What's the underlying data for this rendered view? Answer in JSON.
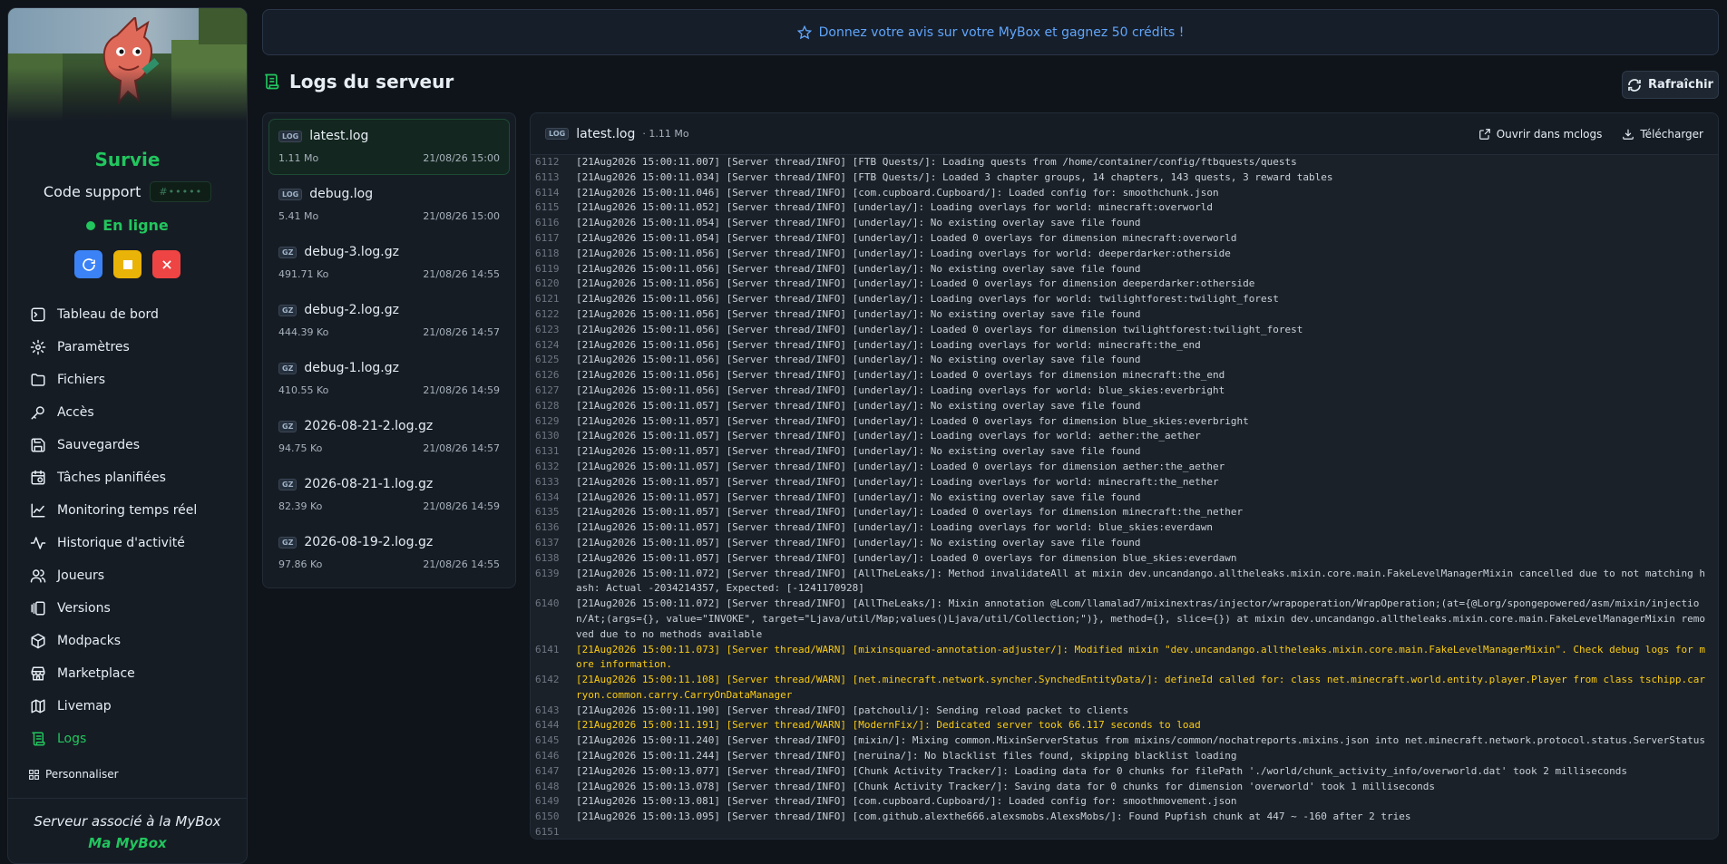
{
  "sidebar": {
    "server_name": "Survie",
    "support_label": "Code support",
    "support_code": "#•••••",
    "status": "En ligne",
    "nav": [
      {
        "label": "Tableau de bord",
        "icon": "terminal-icon"
      },
      {
        "label": "Paramètres",
        "icon": "gear-icon"
      },
      {
        "label": "Fichiers",
        "icon": "folder-icon"
      },
      {
        "label": "Accès",
        "icon": "key-icon"
      },
      {
        "label": "Sauvegardes",
        "icon": "save-icon"
      },
      {
        "label": "Tâches planifiées",
        "icon": "calendar-clock-icon"
      },
      {
        "label": "Monitoring temps réel",
        "icon": "chart-line-icon"
      },
      {
        "label": "Historique d'activité",
        "icon": "activity-icon"
      },
      {
        "label": "Joueurs",
        "icon": "users-icon"
      },
      {
        "label": "Versions",
        "icon": "versions-icon"
      },
      {
        "label": "Modpacks",
        "icon": "package-icon"
      },
      {
        "label": "Marketplace",
        "icon": "store-icon"
      },
      {
        "label": "Livemap",
        "icon": "map-icon"
      },
      {
        "label": "Logs",
        "icon": "scroll-icon"
      }
    ],
    "customize": "Personnaliser",
    "footer_text": "Serveur associé à la MyBox",
    "footer_link": "Ma MyBox"
  },
  "notice": "Donnez votre avis sur votre MyBox et gagnez 50 crédits !",
  "page_title": "Logs du serveur",
  "refresh_label": "Rafraîchir",
  "files": [
    {
      "badge": "LOG",
      "name": "latest.log",
      "size": "1.11 Mo",
      "date": "21/08/26 15:00"
    },
    {
      "badge": "LOG",
      "name": "debug.log",
      "size": "5.41 Mo",
      "date": "21/08/26 15:00"
    },
    {
      "badge": "GZ",
      "name": "debug-3.log.gz",
      "size": "491.71 Ko",
      "date": "21/08/26 14:55"
    },
    {
      "badge": "GZ",
      "name": "debug-2.log.gz",
      "size": "444.39 Ko",
      "date": "21/08/26 14:57"
    },
    {
      "badge": "GZ",
      "name": "debug-1.log.gz",
      "size": "410.55 Ko",
      "date": "21/08/26 14:59"
    },
    {
      "badge": "GZ",
      "name": "2026-08-21-2.log.gz",
      "size": "94.75 Ko",
      "date": "21/08/26 14:57"
    },
    {
      "badge": "GZ",
      "name": "2026-08-21-1.log.gz",
      "size": "82.39 Ko",
      "date": "21/08/26 14:59"
    },
    {
      "badge": "GZ",
      "name": "2026-08-19-2.log.gz",
      "size": "97.86 Ko",
      "date": "21/08/26 14:55"
    }
  ],
  "viewer": {
    "badge": "LOG",
    "file_name": "latest.log",
    "file_size": "· 1.11 Mo",
    "open_mclogs": "Ouvrir dans mclogs",
    "download": "Télécharger",
    "lines": [
      {
        "n": "6112",
        "t": "[21Aug2026 15:00:11.007] [Server thread/INFO] [FTB Quests/]: Loading quests from /home/container/config/ftbquests/quests",
        "w": false
      },
      {
        "n": "6113",
        "t": "[21Aug2026 15:00:11.034] [Server thread/INFO] [FTB Quests/]: Loaded 3 chapter groups, 14 chapters, 143 quests, 3 reward tables",
        "w": false
      },
      {
        "n": "6114",
        "t": "[21Aug2026 15:00:11.046] [Server thread/INFO] [com.cupboard.Cupboard/]: Loaded config for: smoothchunk.json",
        "w": false
      },
      {
        "n": "6115",
        "t": "[21Aug2026 15:00:11.052] [Server thread/INFO] [underlay/]: Loading overlays for world: minecraft:overworld",
        "w": false
      },
      {
        "n": "6116",
        "t": "[21Aug2026 15:00:11.054] [Server thread/INFO] [underlay/]: No existing overlay save file found",
        "w": false
      },
      {
        "n": "6117",
        "t": "[21Aug2026 15:00:11.054] [Server thread/INFO] [underlay/]: Loaded 0 overlays for dimension minecraft:overworld",
        "w": false
      },
      {
        "n": "6118",
        "t": "[21Aug2026 15:00:11.056] [Server thread/INFO] [underlay/]: Loading overlays for world: deeperdarker:otherside",
        "w": false
      },
      {
        "n": "6119",
        "t": "[21Aug2026 15:00:11.056] [Server thread/INFO] [underlay/]: No existing overlay save file found",
        "w": false
      },
      {
        "n": "6120",
        "t": "[21Aug2026 15:00:11.056] [Server thread/INFO] [underlay/]: Loaded 0 overlays for dimension deeperdarker:otherside",
        "w": false
      },
      {
        "n": "6121",
        "t": "[21Aug2026 15:00:11.056] [Server thread/INFO] [underlay/]: Loading overlays for world: twilightforest:twilight_forest",
        "w": false
      },
      {
        "n": "6122",
        "t": "[21Aug2026 15:00:11.056] [Server thread/INFO] [underlay/]: No existing overlay save file found",
        "w": false
      },
      {
        "n": "6123",
        "t": "[21Aug2026 15:00:11.056] [Server thread/INFO] [underlay/]: Loaded 0 overlays for dimension twilightforest:twilight_forest",
        "w": false
      },
      {
        "n": "6124",
        "t": "[21Aug2026 15:00:11.056] [Server thread/INFO] [underlay/]: Loading overlays for world: minecraft:the_end",
        "w": false
      },
      {
        "n": "6125",
        "t": "[21Aug2026 15:00:11.056] [Server thread/INFO] [underlay/]: No existing overlay save file found",
        "w": false
      },
      {
        "n": "6126",
        "t": "[21Aug2026 15:00:11.056] [Server thread/INFO] [underlay/]: Loaded 0 overlays for dimension minecraft:the_end",
        "w": false
      },
      {
        "n": "6127",
        "t": "[21Aug2026 15:00:11.056] [Server thread/INFO] [underlay/]: Loading overlays for world: blue_skies:everbright",
        "w": false
      },
      {
        "n": "6128",
        "t": "[21Aug2026 15:00:11.057] [Server thread/INFO] [underlay/]: No existing overlay save file found",
        "w": false
      },
      {
        "n": "6129",
        "t": "[21Aug2026 15:00:11.057] [Server thread/INFO] [underlay/]: Loaded 0 overlays for dimension blue_skies:everbright",
        "w": false
      },
      {
        "n": "6130",
        "t": "[21Aug2026 15:00:11.057] [Server thread/INFO] [underlay/]: Loading overlays for world: aether:the_aether",
        "w": false
      },
      {
        "n": "6131",
        "t": "[21Aug2026 15:00:11.057] [Server thread/INFO] [underlay/]: No existing overlay save file found",
        "w": false
      },
      {
        "n": "6132",
        "t": "[21Aug2026 15:00:11.057] [Server thread/INFO] [underlay/]: Loaded 0 overlays for dimension aether:the_aether",
        "w": false
      },
      {
        "n": "6133",
        "t": "[21Aug2026 15:00:11.057] [Server thread/INFO] [underlay/]: Loading overlays for world: minecraft:the_nether",
        "w": false
      },
      {
        "n": "6134",
        "t": "[21Aug2026 15:00:11.057] [Server thread/INFO] [underlay/]: No existing overlay save file found",
        "w": false
      },
      {
        "n": "6135",
        "t": "[21Aug2026 15:00:11.057] [Server thread/INFO] [underlay/]: Loaded 0 overlays for dimension minecraft:the_nether",
        "w": false
      },
      {
        "n": "6136",
        "t": "[21Aug2026 15:00:11.057] [Server thread/INFO] [underlay/]: Loading overlays for world: blue_skies:everdawn",
        "w": false
      },
      {
        "n": "6137",
        "t": "[21Aug2026 15:00:11.057] [Server thread/INFO] [underlay/]: No existing overlay save file found",
        "w": false
      },
      {
        "n": "6138",
        "t": "[21Aug2026 15:00:11.057] [Server thread/INFO] [underlay/]: Loaded 0 overlays for dimension blue_skies:everdawn",
        "w": false
      },
      {
        "n": "6139",
        "t": "[21Aug2026 15:00:11.072] [Server thread/INFO] [AllTheLeaks/]: Method invalidateAll at mixin dev.uncandango.alltheleaks.mixin.core.main.FakeLevelManagerMixin cancelled due to not matching hash: Actual -2034214357, Expected: [-1241170928]",
        "w": false
      },
      {
        "n": "6140",
        "t": "[21Aug2026 15:00:11.072] [Server thread/INFO] [AllTheLeaks/]: Mixin annotation @Lcom/llamalad7/mixinextras/injector/wrapoperation/WrapOperation;(at={@Lorg/spongepowered/asm/mixin/injection/At;(args={}, value=\"INVOKE\", target=\"Ljava/util/Map;values()Ljava/util/Collection;\")}, method={}, slice={}) at mixin dev.uncandango.alltheleaks.mixin.core.main.FakeLevelManagerMixin removed due to no methods available",
        "w": false
      },
      {
        "n": "6141",
        "t": "[21Aug2026 15:00:11.073] [Server thread/WARN] [mixinsquared-annotation-adjuster/]: Modified mixin \"dev.uncandango.alltheleaks.mixin.core.main.FakeLevelManagerMixin\". Check debug logs for more information.",
        "w": true
      },
      {
        "n": "6142",
        "t": "[21Aug2026 15:00:11.108] [Server thread/WARN] [net.minecraft.network.syncher.SynchedEntityData/]: defineId called for: class net.minecraft.world.entity.player.Player from class tschipp.carryon.common.carry.CarryOnDataManager",
        "w": true
      },
      {
        "n": "6143",
        "t": "[21Aug2026 15:00:11.190] [Server thread/INFO] [patchouli/]: Sending reload packet to clients",
        "w": false
      },
      {
        "n": "6144",
        "t": "[21Aug2026 15:00:11.191] [Server thread/WARN] [ModernFix/]: Dedicated server took 66.117 seconds to load",
        "w": true
      },
      {
        "n": "6145",
        "t": "[21Aug2026 15:00:11.240] [Server thread/INFO] [mixin/]: Mixing common.MixinServerStatus from mixins/common/nochatreports.mixins.json into net.minecraft.network.protocol.status.ServerStatus",
        "w": false
      },
      {
        "n": "6146",
        "t": "[21Aug2026 15:00:11.244] [Server thread/INFO] [neruina/]: No blacklist files found, skipping blacklist loading",
        "w": false
      },
      {
        "n": "6147",
        "t": "[21Aug2026 15:00:13.077] [Server thread/INFO] [Chunk Activity Tracker/]: Loading data for 0 chunks for filePath './world/chunk_activity_info/overworld.dat' took 2 milliseconds",
        "w": false
      },
      {
        "n": "6148",
        "t": "[21Aug2026 15:00:13.078] [Server thread/INFO] [Chunk Activity Tracker/]: Saving data for 0 chunks for dimension 'overworld' took 1 milliseconds",
        "w": false
      },
      {
        "n": "6149",
        "t": "[21Aug2026 15:00:13.081] [Server thread/INFO] [com.cupboard.Cupboard/]: Loaded config for: smoothmovement.json",
        "w": false
      },
      {
        "n": "6150",
        "t": "[21Aug2026 15:00:13.095] [Server thread/INFO] [com.github.alexthe666.alexsmobs.AlexsMobs/]: Found Pupfish chunk at 447 ~ -160 after 2 tries",
        "w": false
      },
      {
        "n": "6151",
        "t": "",
        "w": false
      }
    ]
  }
}
